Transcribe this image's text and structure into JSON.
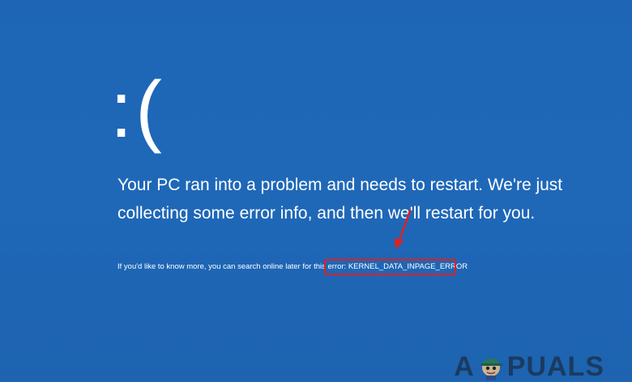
{
  "screen": {
    "sad_face": ":(",
    "main_message": "Your PC ran into a problem and needs to restart. We're just collecting some error info, and then we'll restart for you.",
    "more_info_prefix": "If you'd like to know more, you can search online later for this error:",
    "error_code": "KERNEL_DATA_INPAGE_ERROR",
    "background_color": "#1f67b6",
    "text_color": "#ffffff"
  },
  "annotation": {
    "box_color": "#e02020",
    "arrow_color": "#e02020"
  },
  "watermark": {
    "text_before": "A",
    "text_after": "PUALS"
  }
}
